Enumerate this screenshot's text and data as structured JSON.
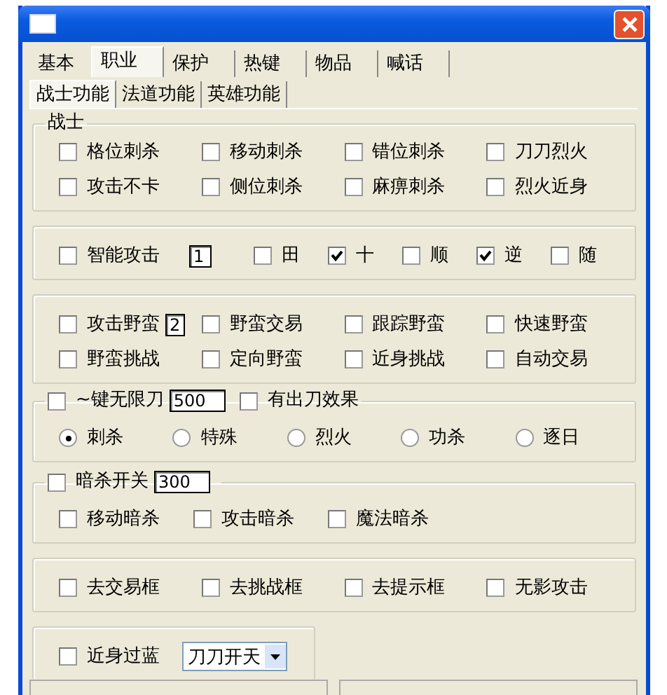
{
  "tabs": [
    {
      "label": "基本",
      "selected": false
    },
    {
      "label": "职业",
      "selected": true
    },
    {
      "label": "保护",
      "selected": false
    },
    {
      "label": "热键",
      "selected": false
    },
    {
      "label": "物品",
      "selected": false
    },
    {
      "label": "喊话",
      "selected": false
    }
  ],
  "subtabs": [
    {
      "label": "战士功能",
      "selected": true
    },
    {
      "label": "法道功能",
      "selected": false
    },
    {
      "label": "英雄功能",
      "selected": false
    }
  ],
  "groups": [
    {
      "legend": [
        {
          "kind": "text",
          "label": "战士"
        }
      ],
      "rows": [
        [
          {
            "kind": "checkbox",
            "label": "格位刺杀",
            "checked": false
          },
          {
            "kind": "checkbox",
            "label": "移动刺杀",
            "checked": false
          },
          {
            "kind": "checkbox",
            "label": "错位刺杀",
            "checked": false
          },
          {
            "kind": "checkbox",
            "label": "刀刀烈火",
            "checked": false
          }
        ],
        [
          {
            "kind": "checkbox",
            "label": "攻击不卡",
            "checked": false
          },
          {
            "kind": "checkbox",
            "label": "侧位刺杀",
            "checked": false
          },
          {
            "kind": "checkbox",
            "label": "麻痹刺杀",
            "checked": false
          },
          {
            "kind": "checkbox",
            "label": "烈火近身",
            "checked": false
          }
        ]
      ]
    },
    {
      "rows": [
        [
          {
            "kind": "checkbox",
            "label": "智能攻击",
            "checked": false
          },
          {
            "kind": "field",
            "value": "1"
          },
          {
            "kind": "checkbox",
            "label": "田",
            "checked": false
          },
          {
            "kind": "checkbox",
            "label": "十",
            "checked": true
          },
          {
            "kind": "checkbox",
            "label": "顺",
            "checked": false
          },
          {
            "kind": "checkbox",
            "label": "逆",
            "checked": true
          },
          {
            "kind": "checkbox",
            "label": "随",
            "checked": false
          }
        ]
      ]
    },
    {
      "rows": [
        [
          {
            "kind": "checkbox",
            "label": "攻击野蛮",
            "checked": false,
            "field": "2"
          },
          {
            "kind": "checkbox",
            "label": "野蛮交易",
            "checked": false
          },
          {
            "kind": "checkbox",
            "label": "跟踪野蛮",
            "checked": false
          },
          {
            "kind": "checkbox",
            "label": "快速野蛮",
            "checked": false
          }
        ],
        [
          {
            "kind": "checkbox",
            "label": "野蛮挑战",
            "checked": false
          },
          {
            "kind": "checkbox",
            "label": "定向野蛮",
            "checked": false
          },
          {
            "kind": "checkbox",
            "label": "近身挑战",
            "checked": false
          },
          {
            "kind": "checkbox",
            "label": "自动交易",
            "checked": false
          }
        ]
      ]
    },
    {
      "legend": [
        {
          "kind": "checkbox",
          "label": "~键无限刀",
          "checked": false
        },
        {
          "kind": "field",
          "value": "500"
        },
        {
          "kind": "checkbox",
          "label": "有出刀效果",
          "checked": false
        }
      ],
      "rows": [
        [
          {
            "kind": "radio",
            "label": "刺杀",
            "selected": true
          },
          {
            "kind": "radio",
            "label": "特殊",
            "selected": false
          },
          {
            "kind": "radio",
            "label": "烈火",
            "selected": false
          },
          {
            "kind": "radio",
            "label": "功杀",
            "selected": false
          },
          {
            "kind": "radio",
            "label": "逐日",
            "selected": false
          }
        ]
      ]
    },
    {
      "legend": [
        {
          "kind": "checkbox",
          "label": "暗杀开关",
          "checked": false
        },
        {
          "kind": "field",
          "value": "300"
        }
      ],
      "rows": [
        [
          {
            "kind": "checkbox",
            "label": "移动暗杀",
            "checked": false
          },
          {
            "kind": "checkbox",
            "label": "攻击暗杀",
            "checked": false
          },
          {
            "kind": "checkbox",
            "label": "魔法暗杀",
            "checked": false
          }
        ]
      ]
    },
    {
      "rows": [
        [
          {
            "kind": "checkbox",
            "label": "去交易框",
            "checked": false
          },
          {
            "kind": "checkbox",
            "label": "去挑战框",
            "checked": false
          },
          {
            "kind": "checkbox",
            "label": "去提示框",
            "checked": false
          },
          {
            "kind": "checkbox",
            "label": "无影攻击",
            "checked": false
          }
        ]
      ]
    },
    {
      "rows": [
        [
          {
            "kind": "checkbox",
            "label": "近身过蓝",
            "checked": false
          },
          {
            "kind": "dropdown",
            "value": "刀刀开天"
          }
        ]
      ]
    }
  ]
}
